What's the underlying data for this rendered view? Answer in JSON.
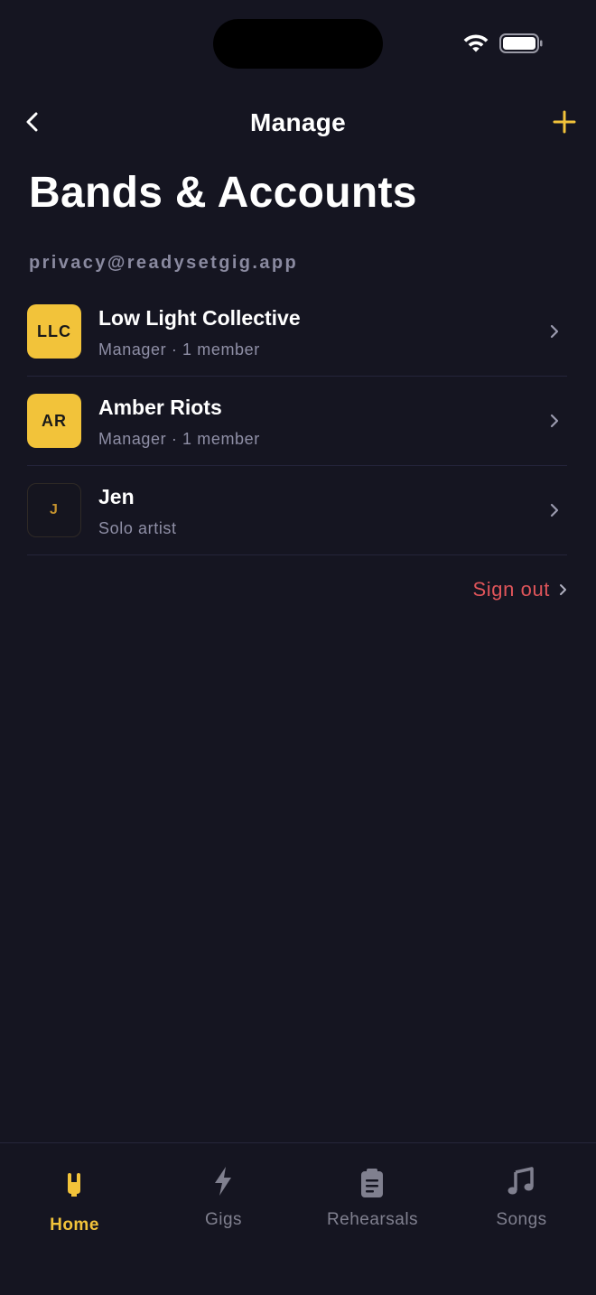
{
  "nav": {
    "title": "Manage"
  },
  "page": {
    "title": "Bands & Accounts",
    "email": "privacy@readysetgig.app"
  },
  "bands": [
    {
      "initials": "LLC",
      "name": "Low Light Collective",
      "meta": "Manager · 1 member"
    },
    {
      "initials": "AR",
      "name": "Amber Riots",
      "meta": "Manager · 1 member"
    },
    {
      "initials": "J",
      "name": "Jen",
      "meta": "Solo artist"
    }
  ],
  "sign_out": {
    "label": "Sign out"
  },
  "tabs": [
    {
      "label": "Home",
      "icon": "rock-hand-icon",
      "active": true
    },
    {
      "label": "Gigs",
      "icon": "lightning-icon",
      "active": false
    },
    {
      "label": "Rehearsals",
      "icon": "clipboard-icon",
      "active": false
    },
    {
      "label": "Songs",
      "icon": "music-note-icon",
      "active": false
    }
  ],
  "colors": {
    "background": "#151521",
    "accent": "#f2c33a",
    "danger": "#e0555a",
    "muted_text": "#8f8fa6"
  }
}
